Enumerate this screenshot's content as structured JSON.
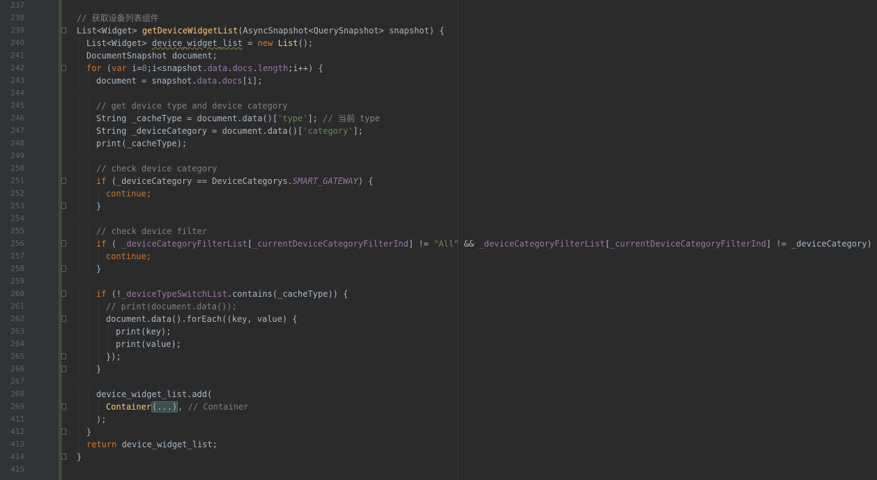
{
  "editor": {
    "lines": [
      {
        "n": "237",
        "fold": false,
        "indent": 0,
        "tokens": []
      },
      {
        "n": "238",
        "fold": false,
        "indent": 0,
        "tokens": [
          {
            "t": "// 获取设备列表组件",
            "c": "comment"
          }
        ]
      },
      {
        "n": "239",
        "fold": true,
        "indent": 0,
        "tokens": [
          {
            "t": "List<Widget> ",
            "c": ""
          },
          {
            "t": "getDeviceWidgetList",
            "c": "fn"
          },
          {
            "t": "(AsyncSnapshot<QuerySnapshot> snapshot) {",
            "c": ""
          }
        ]
      },
      {
        "n": "240",
        "fold": false,
        "indent": 1,
        "tokens": [
          {
            "t": "List<Widget> ",
            "c": ""
          },
          {
            "t": "device_widget_list",
            "c": "underline"
          },
          {
            "t": " = ",
            "c": ""
          },
          {
            "t": "new ",
            "c": "kw"
          },
          {
            "t": "List",
            "c": "cls"
          },
          {
            "t": "();",
            "c": ""
          }
        ]
      },
      {
        "n": "241",
        "fold": false,
        "indent": 1,
        "tokens": [
          {
            "t": "DocumentSnapshot document;",
            "c": ""
          }
        ]
      },
      {
        "n": "242",
        "fold": true,
        "indent": 1,
        "tokens": [
          {
            "t": "for ",
            "c": "kw"
          },
          {
            "t": "(",
            "c": ""
          },
          {
            "t": "var ",
            "c": "kw"
          },
          {
            "t": "i=",
            "c": ""
          },
          {
            "t": "0",
            "c": "num"
          },
          {
            "t": ";i<snapshot.",
            "c": ""
          },
          {
            "t": "data",
            "c": "field"
          },
          {
            "t": ".",
            "c": ""
          },
          {
            "t": "docs",
            "c": "field"
          },
          {
            "t": ".",
            "c": ""
          },
          {
            "t": "length",
            "c": "field"
          },
          {
            "t": ";i++) {",
            "c": ""
          }
        ]
      },
      {
        "n": "243",
        "fold": false,
        "indent": 2,
        "tokens": [
          {
            "t": "document = snapshot.",
            "c": ""
          },
          {
            "t": "data",
            "c": "field"
          },
          {
            "t": ".",
            "c": ""
          },
          {
            "t": "docs",
            "c": "field"
          },
          {
            "t": "[i];",
            "c": ""
          }
        ]
      },
      {
        "n": "244",
        "fold": false,
        "indent": 0,
        "tokens": []
      },
      {
        "n": "245",
        "fold": false,
        "indent": 2,
        "tokens": [
          {
            "t": "// get device type and device category",
            "c": "comment"
          }
        ]
      },
      {
        "n": "246",
        "fold": false,
        "indent": 2,
        "tokens": [
          {
            "t": "String _cacheType = document.data()[",
            "c": ""
          },
          {
            "t": "'type'",
            "c": "str"
          },
          {
            "t": "]; ",
            "c": ""
          },
          {
            "t": "// 当前 type",
            "c": "comment"
          }
        ]
      },
      {
        "n": "247",
        "fold": false,
        "indent": 2,
        "tokens": [
          {
            "t": "String _deviceCategory = document.data()[",
            "c": ""
          },
          {
            "t": "'category'",
            "c": "str"
          },
          {
            "t": "];",
            "c": ""
          }
        ]
      },
      {
        "n": "248",
        "fold": false,
        "indent": 2,
        "tokens": [
          {
            "t": "print(_cacheType);",
            "c": ""
          }
        ]
      },
      {
        "n": "249",
        "fold": false,
        "indent": 0,
        "tokens": []
      },
      {
        "n": "250",
        "fold": false,
        "indent": 2,
        "tokens": [
          {
            "t": "// check device category",
            "c": "comment"
          }
        ]
      },
      {
        "n": "251",
        "fold": true,
        "indent": 2,
        "tokens": [
          {
            "t": "if ",
            "c": "kw"
          },
          {
            "t": "(_deviceCategory == DeviceCategorys.",
            "c": ""
          },
          {
            "t": "SMART_GATEWAY",
            "c": "italic"
          },
          {
            "t": ") {",
            "c": ""
          }
        ]
      },
      {
        "n": "252",
        "fold": false,
        "indent": 3,
        "tokens": [
          {
            "t": "continue;",
            "c": "kw"
          }
        ]
      },
      {
        "n": "253",
        "fold": true,
        "indent": 2,
        "tokens": [
          {
            "t": "}",
            "c": ""
          }
        ]
      },
      {
        "n": "254",
        "fold": false,
        "indent": 0,
        "tokens": []
      },
      {
        "n": "255",
        "fold": false,
        "indent": 2,
        "tokens": [
          {
            "t": "// check device filter",
            "c": "comment"
          }
        ]
      },
      {
        "n": "256",
        "fold": true,
        "indent": 2,
        "tokens": [
          {
            "t": "if ",
            "c": "kw"
          },
          {
            "t": "( ",
            "c": ""
          },
          {
            "t": "_deviceCategoryFilterList",
            "c": "field"
          },
          {
            "t": "[",
            "c": ""
          },
          {
            "t": "_currentDeviceCategoryFilterInd",
            "c": "field"
          },
          {
            "t": "] != ",
            "c": ""
          },
          {
            "t": "\"All\"",
            "c": "str"
          },
          {
            "t": " && ",
            "c": ""
          },
          {
            "t": "_deviceCategoryFilterList",
            "c": "field"
          },
          {
            "t": "[",
            "c": ""
          },
          {
            "t": "_currentDeviceCategoryFilterInd",
            "c": "field"
          },
          {
            "t": "] != _deviceCategory) {",
            "c": ""
          }
        ]
      },
      {
        "n": "257",
        "fold": false,
        "indent": 3,
        "tokens": [
          {
            "t": "continue;",
            "c": "kw"
          }
        ]
      },
      {
        "n": "258",
        "fold": true,
        "indent": 2,
        "tokens": [
          {
            "t": "}",
            "c": ""
          }
        ]
      },
      {
        "n": "259",
        "fold": false,
        "indent": 0,
        "tokens": []
      },
      {
        "n": "260",
        "fold": true,
        "indent": 2,
        "tokens": [
          {
            "t": "if ",
            "c": "kw"
          },
          {
            "t": "(!",
            "c": ""
          },
          {
            "t": "_deviceTypeSwitchList",
            "c": "field"
          },
          {
            "t": ".contains(_cacheType)) {",
            "c": ""
          }
        ]
      },
      {
        "n": "261",
        "fold": false,
        "indent": 3,
        "tokens": [
          {
            "t": "// print(document.data());",
            "c": "comment"
          }
        ]
      },
      {
        "n": "262",
        "fold": true,
        "indent": 3,
        "tokens": [
          {
            "t": "document.data().forEach((key, value) {",
            "c": ""
          }
        ]
      },
      {
        "n": "263",
        "fold": false,
        "indent": 4,
        "tokens": [
          {
            "t": "print(key);",
            "c": ""
          }
        ]
      },
      {
        "n": "264",
        "fold": false,
        "indent": 4,
        "tokens": [
          {
            "t": "print(value);",
            "c": ""
          }
        ]
      },
      {
        "n": "265",
        "fold": true,
        "indent": 3,
        "tokens": [
          {
            "t": "});",
            "c": ""
          }
        ]
      },
      {
        "n": "266",
        "fold": true,
        "indent": 2,
        "tokens": [
          {
            "t": "}",
            "c": ""
          }
        ]
      },
      {
        "n": "267",
        "fold": false,
        "indent": 0,
        "tokens": []
      },
      {
        "n": "268",
        "fold": false,
        "indent": 2,
        "tokens": [
          {
            "t": "device_widget_list.add(",
            "c": ""
          }
        ]
      },
      {
        "n": "269",
        "fold": true,
        "indent": 3,
        "tokens": [
          {
            "t": "Container",
            "c": "cls"
          },
          {
            "t": "(...)",
            "c": "folded"
          },
          {
            "t": ", ",
            "c": ""
          },
          {
            "t": "// Container",
            "c": "comment"
          }
        ]
      },
      {
        "n": "411",
        "fold": false,
        "indent": 2,
        "tokens": [
          {
            "t": ");",
            "c": ""
          }
        ]
      },
      {
        "n": "412",
        "fold": true,
        "indent": 1,
        "tokens": [
          {
            "t": "}",
            "c": ""
          }
        ]
      },
      {
        "n": "413",
        "fold": false,
        "indent": 1,
        "tokens": [
          {
            "t": "return ",
            "c": "kw"
          },
          {
            "t": "device_widget_list;",
            "c": ""
          }
        ]
      },
      {
        "n": "414",
        "fold": true,
        "indent": 0,
        "tokens": [
          {
            "t": "}",
            "c": ""
          }
        ]
      },
      {
        "n": "415",
        "fold": false,
        "indent": 0,
        "tokens": []
      }
    ]
  },
  "colors": {
    "background": "#2b2b2b",
    "gutter": "#313335",
    "keyword": "#cc7832",
    "function": "#ffc66d",
    "field": "#9876aa",
    "string": "#6a8759",
    "number": "#6897bb",
    "comment": "#808080"
  }
}
